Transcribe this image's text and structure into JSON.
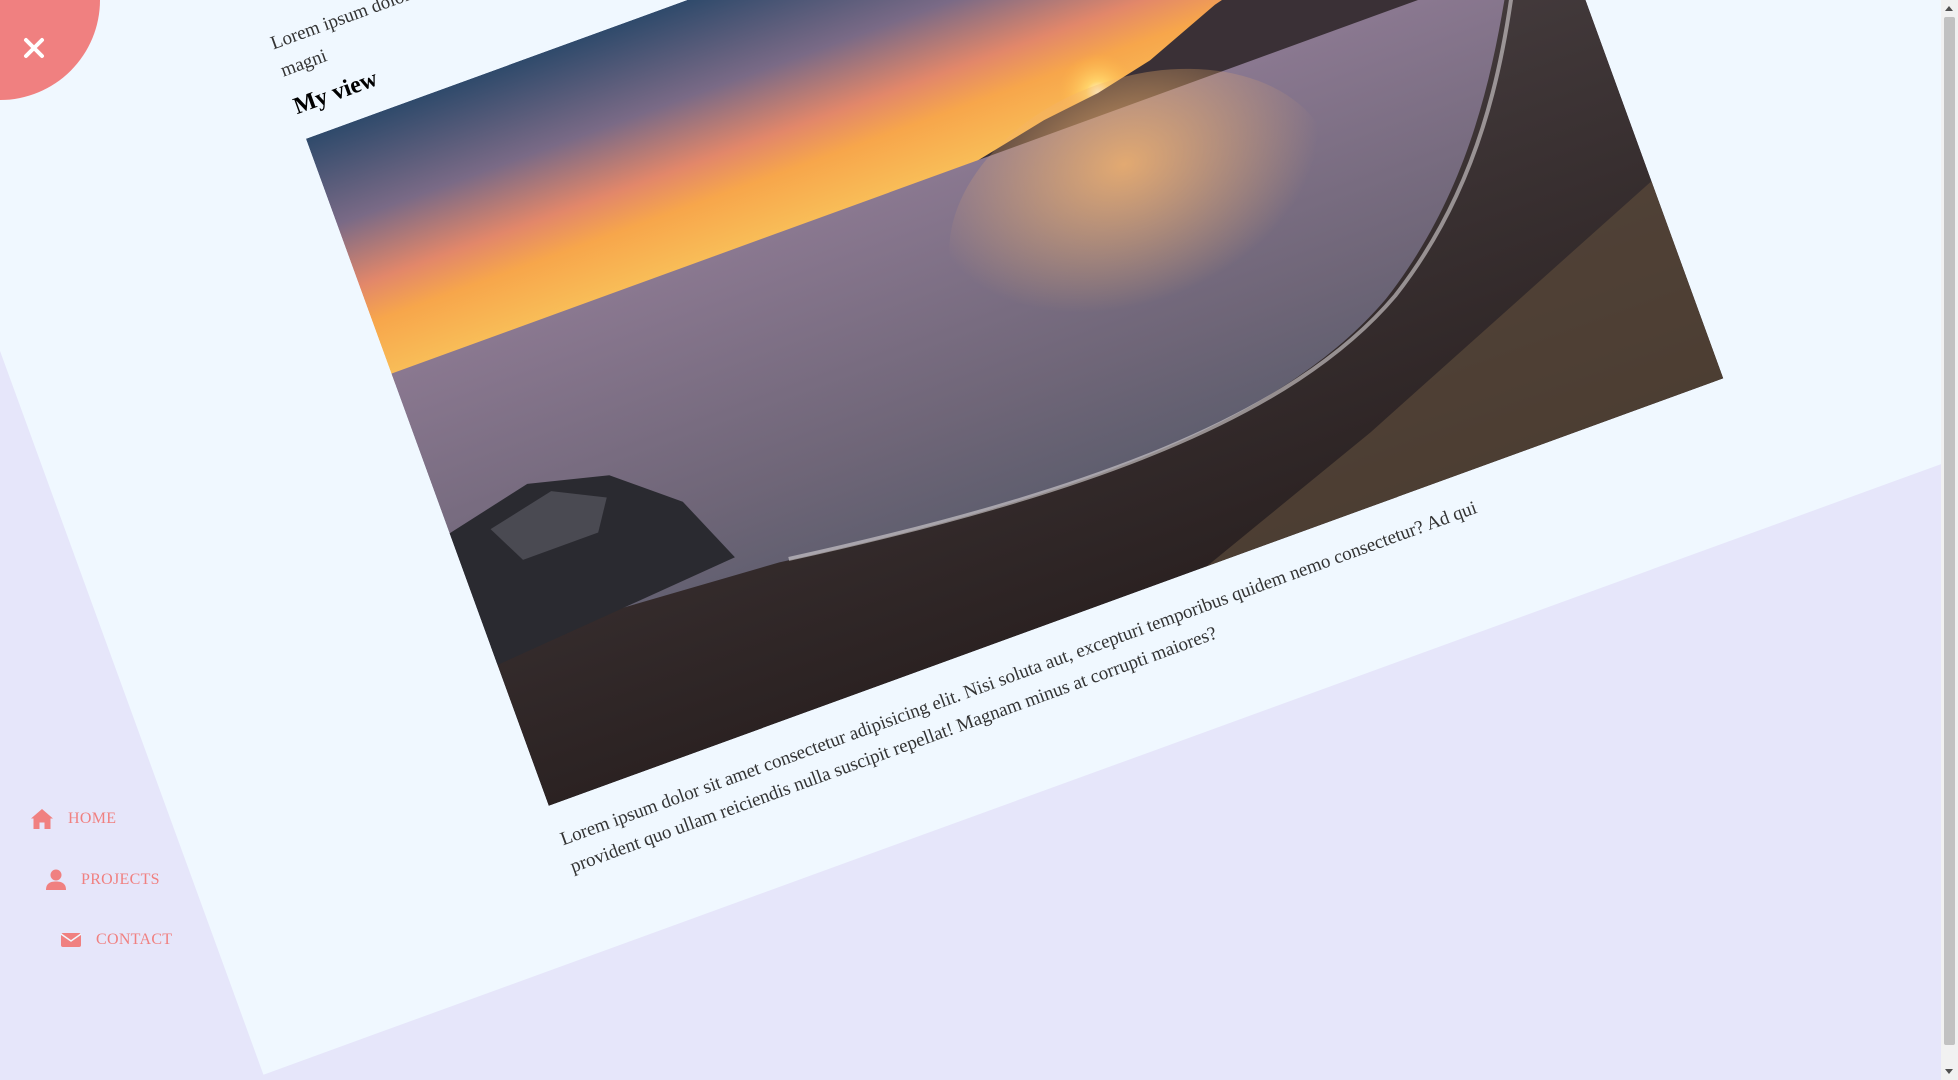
{
  "page": {
    "background": "#e6e6fa",
    "sheet_color": "#f0f8ff",
    "accent": "#f08080"
  },
  "content": {
    "top_paragraph": "Lorem ipsum dolor sit amet consectetur adipisicing elit. Nisi soluta aut, excepturi temporibus quidem nemo consectetur? Ad qui provident quo ullam voluptatem magni",
    "section_title": "My view",
    "image_alt": "Sunset over a bay with a rocky beach",
    "caption": "Lorem ipsum dolor sit amet consectetur adipisicing elit. Nisi soluta aut, excepturi temporibus quidem nemo consectetur? Ad qui provident quo ullam reiciendis nulla suscipit repellat! Magnam minus at corrupti maiores?"
  },
  "close_button": {
    "icon": "close-icon"
  },
  "nav": {
    "items": [
      {
        "label": "HOME",
        "icon": "home-icon"
      },
      {
        "label": "PROJECTS",
        "icon": "user-icon"
      },
      {
        "label": "CONTACT",
        "icon": "envelope-icon"
      }
    ]
  }
}
